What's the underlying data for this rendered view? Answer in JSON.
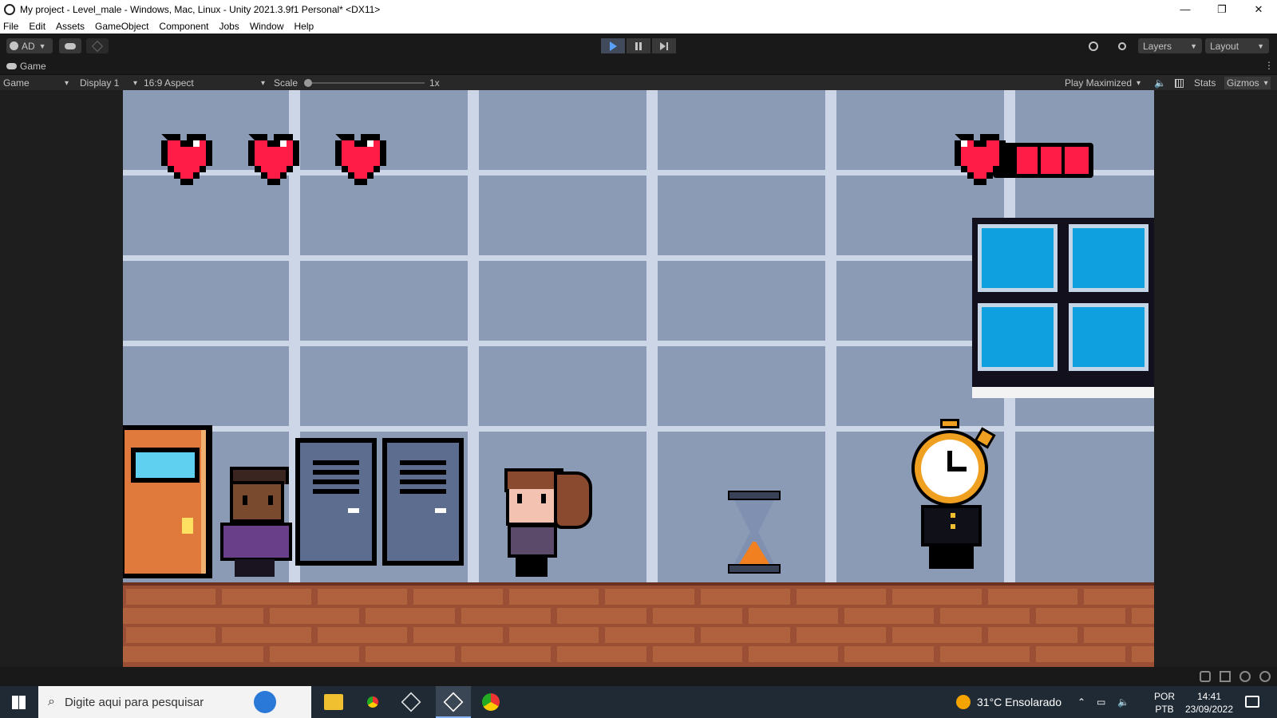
{
  "window": {
    "title": "My project - Level_male - Windows, Mac, Linux - Unity 2021.3.9f1 Personal* <DX11>",
    "minimize": "—",
    "maximize": "❐",
    "close": "✕"
  },
  "menu": [
    "File",
    "Edit",
    "Assets",
    "GameObject",
    "Component",
    "Jobs",
    "Window",
    "Help"
  ],
  "toolbar": {
    "account": "AD",
    "layers": "Layers",
    "layout": "Layout"
  },
  "game_tab": {
    "label": "Game",
    "view_mode": "Game",
    "display": "Display 1",
    "aspect": "16:9 Aspect",
    "scale_label": "Scale",
    "scale_value": "1x",
    "play_mode": "Play Maximized",
    "stats": "Stats",
    "gizmos": "Gizmos"
  },
  "taskbar": {
    "search_placeholder": "Digite aqui para pesquisar",
    "weather": "31°C  Ensolarado",
    "lang_top": "POR",
    "lang_bottom": "PTB",
    "time": "14:41",
    "date": "23/09/2022"
  },
  "colors": {
    "heart": "#ff1c47",
    "wall": "#8b9ab5",
    "grid": "#cdd6e6",
    "floor": "#9b4f34",
    "window_glass": "#0fa0e0",
    "door": "#e07a3c",
    "locker": "#5d6d8f"
  }
}
